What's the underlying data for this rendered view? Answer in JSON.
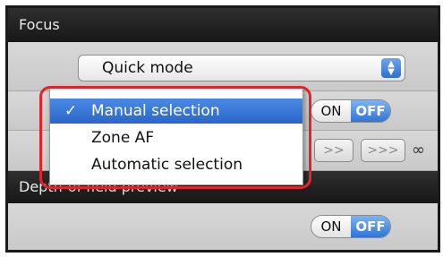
{
  "focus_section": {
    "title": "Focus",
    "mode_select": {
      "value": "Quick mode"
    },
    "af_toggle": {
      "on_label": "ON",
      "off_label": "OFF",
      "selected": "OFF"
    },
    "speed_buttons": [
      ">>",
      ">>>"
    ],
    "infinity_symbol": "∞"
  },
  "dropdown_menu": {
    "items": [
      {
        "label": "Manual selection",
        "checked": true
      },
      {
        "label": "Zone AF",
        "checked": false
      },
      {
        "label": "Automatic selection",
        "checked": false
      }
    ],
    "check_mark": "✓"
  },
  "dof_section": {
    "title": "Depth-of-field preview",
    "toggle": {
      "on_label": "ON",
      "off_label": "OFF",
      "selected": "OFF"
    }
  },
  "colors": {
    "header_bg": "#1f1f1f",
    "accent_blue": "#2f74d6",
    "highlight_red": "#e3222a"
  }
}
